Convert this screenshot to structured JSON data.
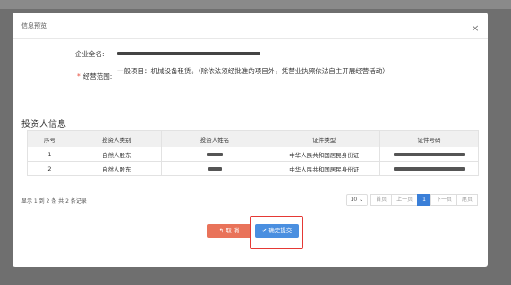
{
  "modal": {
    "title": "信息预览",
    "close_label": "×"
  },
  "form": {
    "company_label": "企业全名:",
    "scope_label": "经营范围:",
    "scope_required_mark": "*",
    "scope_text": "一般项目：机械设备租赁。（除依法须经批准的项目外，凭营业执照依法自主开展经营活动）"
  },
  "investors": {
    "section_title": "投资人信息",
    "columns": [
      "序号",
      "投资人类别",
      "投资人姓名",
      "证件类型",
      "证件号码"
    ],
    "rows": [
      {
        "index": "1",
        "category": "自然人股东",
        "id_type": "中华人民共和国居民身份证"
      },
      {
        "index": "2",
        "category": "自然人股东",
        "id_type": "中华人民共和国居民身份证"
      }
    ],
    "summary": "显示 1 到 2 条 共 2 条记录"
  },
  "pager": {
    "page_size": "10",
    "first": "首页",
    "prev": "上一页",
    "current": "1",
    "next": "下一页",
    "last": "尾页"
  },
  "actions": {
    "cancel_label": "取 消",
    "submit_label": "确定提交",
    "cancel_color": "#e9735a",
    "submit_color": "#4a8fe0",
    "highlight_color": "#e53935"
  }
}
